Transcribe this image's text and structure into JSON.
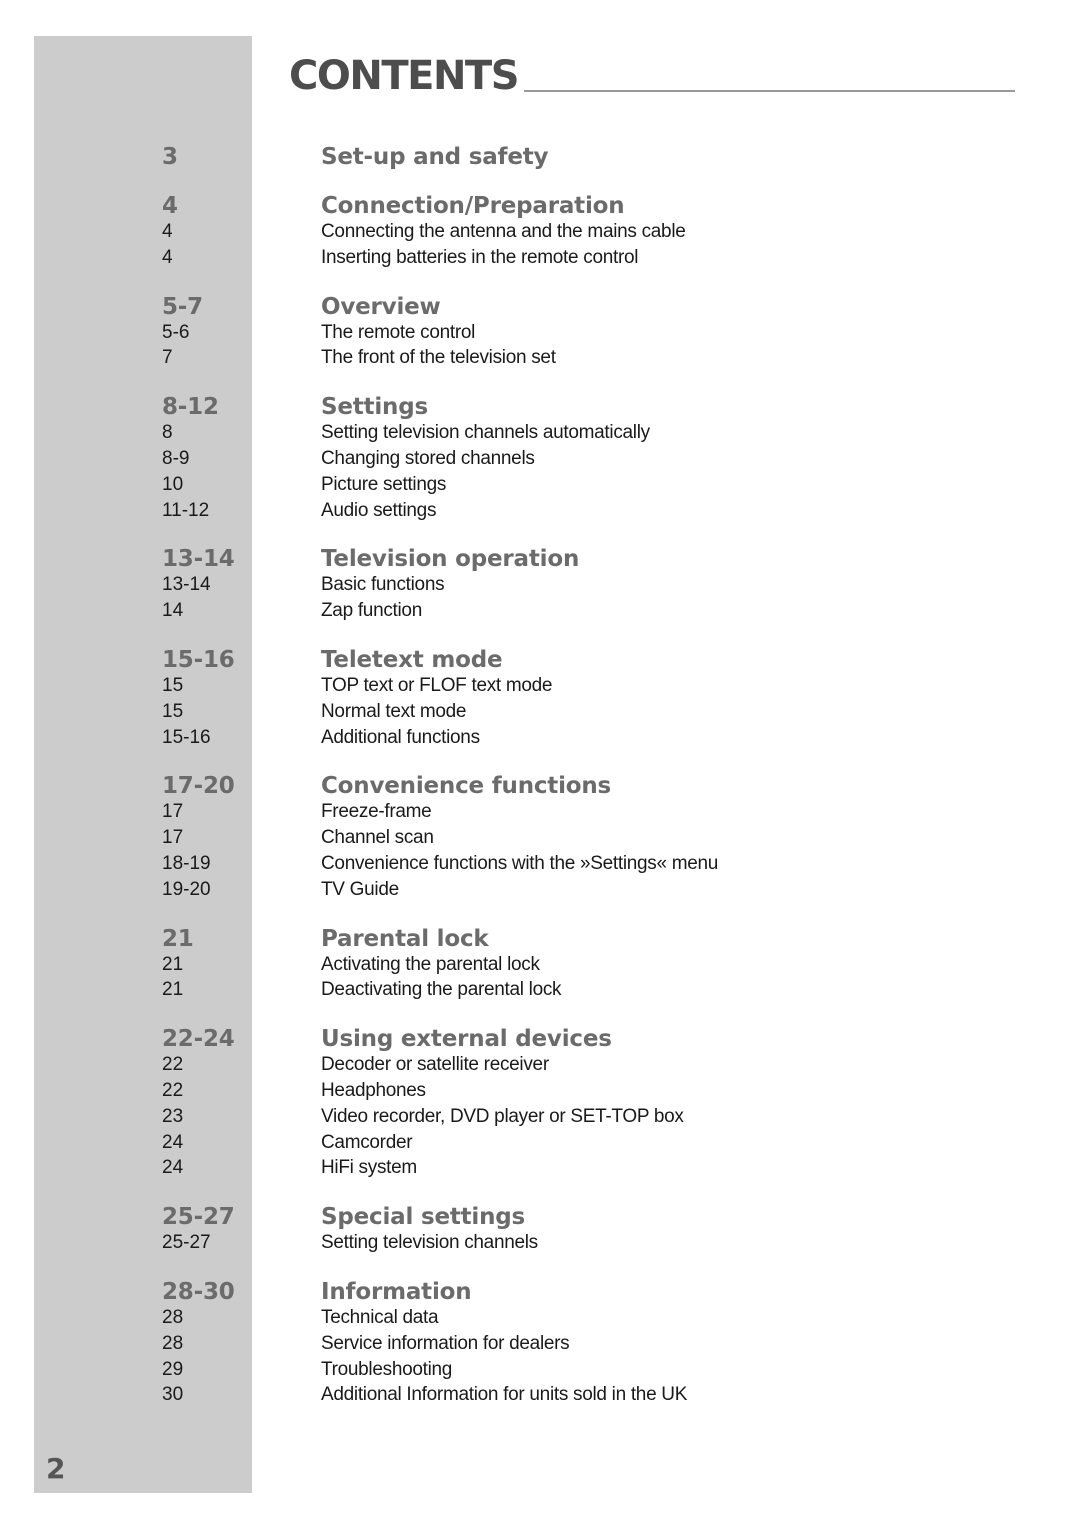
{
  "page": {
    "title": "CONTENTS",
    "page_number": "2"
  },
  "colors": {
    "sidebar": "#cccccc",
    "heading_text": "#6b6b6b",
    "title_text": "#4d4d4d",
    "body_text": "#1a1a1a"
  },
  "sections": [
    {
      "page": "3",
      "heading": "Set-up and safety",
      "items": []
    },
    {
      "page": "4",
      "heading": "Connection/Preparation",
      "items": [
        {
          "page": "4",
          "label": "Connecting the antenna and the mains cable"
        },
        {
          "page": "4",
          "label": "Inserting batteries in the remote control"
        }
      ]
    },
    {
      "page": "5-7",
      "heading": "Overview",
      "items": [
        {
          "page": "5-6",
          "label": "The remote control"
        },
        {
          "page": "7",
          "label": "The front of the television set"
        }
      ]
    },
    {
      "page": "8-12",
      "heading": "Settings",
      "items": [
        {
          "page": "8",
          "label": "Setting television channels automatically"
        },
        {
          "page": "8-9",
          "label": "Changing stored channels"
        },
        {
          "page": "10",
          "label": "Picture settings"
        },
        {
          "page": "11-12",
          "label": "Audio settings"
        }
      ]
    },
    {
      "page": "13-14",
      "heading": "Television operation",
      "items": [
        {
          "page": "13-14",
          "label": "Basic functions"
        },
        {
          "page": "14",
          "label": "Zap function"
        }
      ]
    },
    {
      "page": "15-16",
      "heading": "Teletext mode",
      "items": [
        {
          "page": "15",
          "label": "TOP text or FLOF text mode"
        },
        {
          "page": "15",
          "label": "Normal text mode"
        },
        {
          "page": "15-16",
          "label": "Additional functions"
        }
      ]
    },
    {
      "page": "17-20",
      "heading": "Convenience functions",
      "items": [
        {
          "page": "17",
          "label": "Freeze-frame"
        },
        {
          "page": "17",
          "label": "Channel scan"
        },
        {
          "page": "18-19",
          "label": "Convenience functions with the »Settings« menu"
        },
        {
          "page": "19-20",
          "label": "TV Guide"
        }
      ]
    },
    {
      "page": "21",
      "heading": "Parental lock",
      "items": [
        {
          "page": "21",
          "label": "Activating the parental lock"
        },
        {
          "page": "21",
          "label": "Deactivating the parental lock"
        }
      ]
    },
    {
      "page": "22-24",
      "heading": "Using external devices",
      "items": [
        {
          "page": "22",
          "label": "Decoder or satellite receiver"
        },
        {
          "page": "22",
          "label": "Headphones"
        },
        {
          "page": "23",
          "label": "Video recorder, DVD player or SET-TOP box"
        },
        {
          "page": "24",
          "label": "Camcorder"
        },
        {
          "page": "24",
          "label": "HiFi system"
        }
      ]
    },
    {
      "page": "25-27",
      "heading": "Special settings",
      "items": [
        {
          "page": "25-27",
          "label": "Setting television channels"
        }
      ]
    },
    {
      "page": "28-30",
      "heading": "Information",
      "items": [
        {
          "page": "28",
          "label": "Technical data"
        },
        {
          "page": "28",
          "label": "Service information for dealers"
        },
        {
          "page": "29",
          "label": "Troubleshooting"
        },
        {
          "page": "30",
          "label": "Additional Information for units sold in the UK"
        }
      ]
    }
  ]
}
